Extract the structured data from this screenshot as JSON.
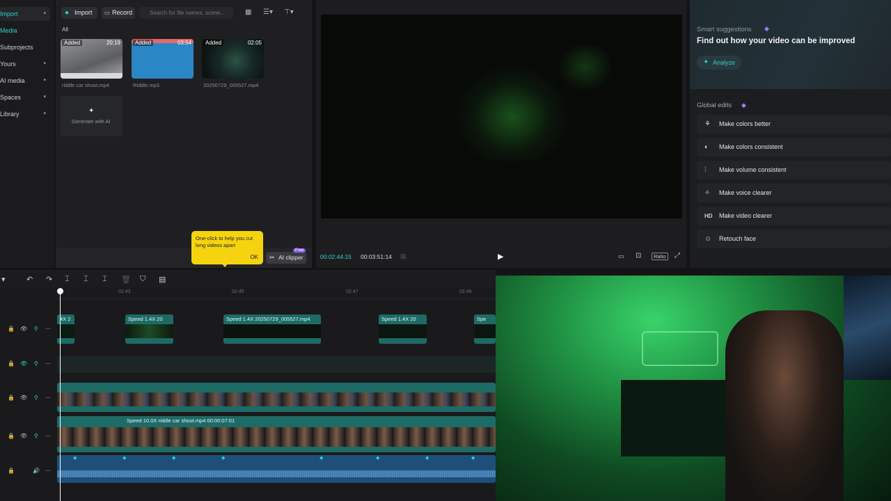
{
  "sidebar": {
    "items": [
      {
        "label": "Import",
        "active": true
      },
      {
        "label": "Media",
        "active": false
      },
      {
        "label": "Subprojects",
        "active": false
      },
      {
        "label": "Yours",
        "active": false
      },
      {
        "label": "AI media",
        "active": false
      },
      {
        "label": "Spaces",
        "active": false
      },
      {
        "label": "Library",
        "active": false
      }
    ]
  },
  "media": {
    "import_label": "Import",
    "record_label": "Record",
    "search_placeholder": "Search for file names, scene...",
    "filter_label": "All",
    "items": [
      {
        "badge": "Added",
        "duration": "20:19",
        "name": "riddle car shoot.mp4"
      },
      {
        "badge": "Added",
        "duration": "03:54",
        "name": "Riddle.mp3"
      },
      {
        "badge": "Added",
        "duration": "02:05",
        "name": "20250729_005527.mp4"
      }
    ],
    "generate_label": "Generate with AI",
    "tooltip_text": "One-click to help you cut long videos apart",
    "tooltip_ok": "OK",
    "ai_clipper_label": "AI clipper",
    "free_badge": "Free"
  },
  "player": {
    "current_time": "00:02:44:15",
    "total_time": "00:03:51:14",
    "ratio_label": "Ratio"
  },
  "right_panel": {
    "smart_title": "Smart suggestions",
    "smart_heading": "Find out how your video can be improved",
    "analyze_label": "Analyze",
    "global_title": "Global edits",
    "edits": [
      {
        "icon": "magic-wand-icon",
        "label": "Make colors better"
      },
      {
        "icon": "palette-icon",
        "label": "Make colors consistent"
      },
      {
        "icon": "equalizer-icon",
        "label": "Make volume consistent"
      },
      {
        "icon": "sparkle-icon",
        "label": "Make voice clearer"
      },
      {
        "icon": "hd-icon",
        "label": "Make video clearer"
      },
      {
        "icon": "face-retouch-icon",
        "label": "Retouch face"
      }
    ]
  },
  "timeline": {
    "ticks": [
      "02:43",
      "02:45",
      "02:47",
      "02:49"
    ],
    "clips_top": [
      {
        "label": "4X  2"
      },
      {
        "label": "Speed 1.4X  20"
      },
      {
        "label": "Speed 1.4X  20250729_005527.mp4"
      },
      {
        "label": "Speed 1.4X  20"
      },
      {
        "label": "Spe"
      }
    ],
    "main_clip_label": "Speed 10.0X   riddle car shoot.mp4   00:00:07:01"
  },
  "colors": {
    "accent": "#2ed2c6",
    "clip_teal": "#1e6b66",
    "audio_blue": "#1d4f7a",
    "tooltip_yellow": "#f5d40f"
  }
}
